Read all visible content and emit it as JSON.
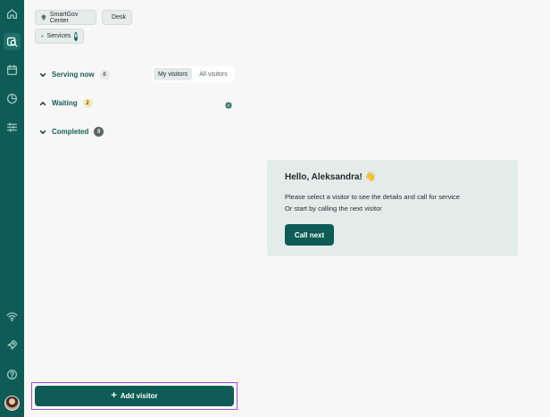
{
  "sidebar": {
    "icons": [
      "home-icon",
      "search-visitors-icon",
      "calendar-icon",
      "statistics-icon",
      "settings-sliders-icon",
      "wifi-icon",
      "rocket-icon",
      "help-icon"
    ],
    "active": "search-visitors-icon"
  },
  "header": {
    "location_label": "SmartGov Center",
    "desk_label": "Desk",
    "services_label": "Services",
    "services_count": "6"
  },
  "queue": {
    "serving_now": {
      "label": "Serving now",
      "count": "0"
    },
    "waiting": {
      "label": "Waiting",
      "count": "2"
    },
    "completed": {
      "label": "Completed",
      "count": "0"
    },
    "filter": {
      "my_visitors": "My visitors",
      "all_visitors": "All visitors",
      "selected": "My visitors"
    }
  },
  "welcome": {
    "greeting": "Hello, Aleksandra!",
    "emoji": "👋",
    "line1": "Please select a visitor to see the details and call for service",
    "line2": "Or start by calling the next visitor",
    "call_next_label": "Call next"
  },
  "actions": {
    "add_visitor_label": "Add visitor"
  },
  "colors": {
    "primary": "#0e5c55",
    "card_bg": "#e4ecea",
    "highlight_border": "#a24ad6"
  }
}
